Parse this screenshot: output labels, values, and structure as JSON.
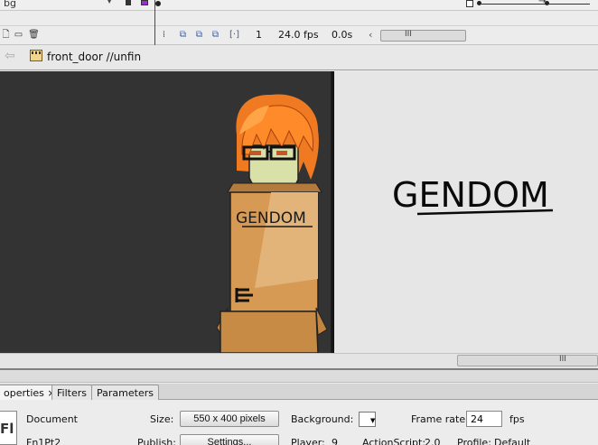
{
  "timeline": {
    "layer_name": "bg",
    "frame_number": "1",
    "fps": "24.0 fps",
    "elapsed": "0.0s",
    "scroll_grip": "III"
  },
  "breadcrumb": {
    "symbol_path": "front_door //unfin"
  },
  "stage": {
    "scroll_grip": "III",
    "artwork_text_left": "GENDOM",
    "artwork_text_right": "GENDOM"
  },
  "properties": {
    "tabs": [
      {
        "label": "operties ×",
        "active": true
      },
      {
        "label": "Filters",
        "active": false
      },
      {
        "label": "Parameters",
        "active": false
      }
    ],
    "logo_text": "Fl",
    "document_label": "Document",
    "document_name": "Fn1Pt2",
    "size_label": "Size:",
    "size_value": "550 x 400 pixels",
    "publish_label": "Publish:",
    "settings_label": "Settings...",
    "background_label": "Background:",
    "background_color": "#ffffff",
    "player_label": "Player:",
    "player_value": "9",
    "framerate_label": "Frame rate:",
    "framerate_value": "24",
    "fps_unit": "fps",
    "actionscript_label": "ActionScript:",
    "actionscript_value": "2.0",
    "profile_label": "Profile:",
    "profile_value": "Default"
  },
  "colors": {
    "stage_dark": "#333333",
    "pasteboard": "#e6e6e6",
    "layer_color": "#9b2fd0",
    "playhead": "#c0171b",
    "hair": "#f07a22",
    "box": "#d69a55"
  }
}
